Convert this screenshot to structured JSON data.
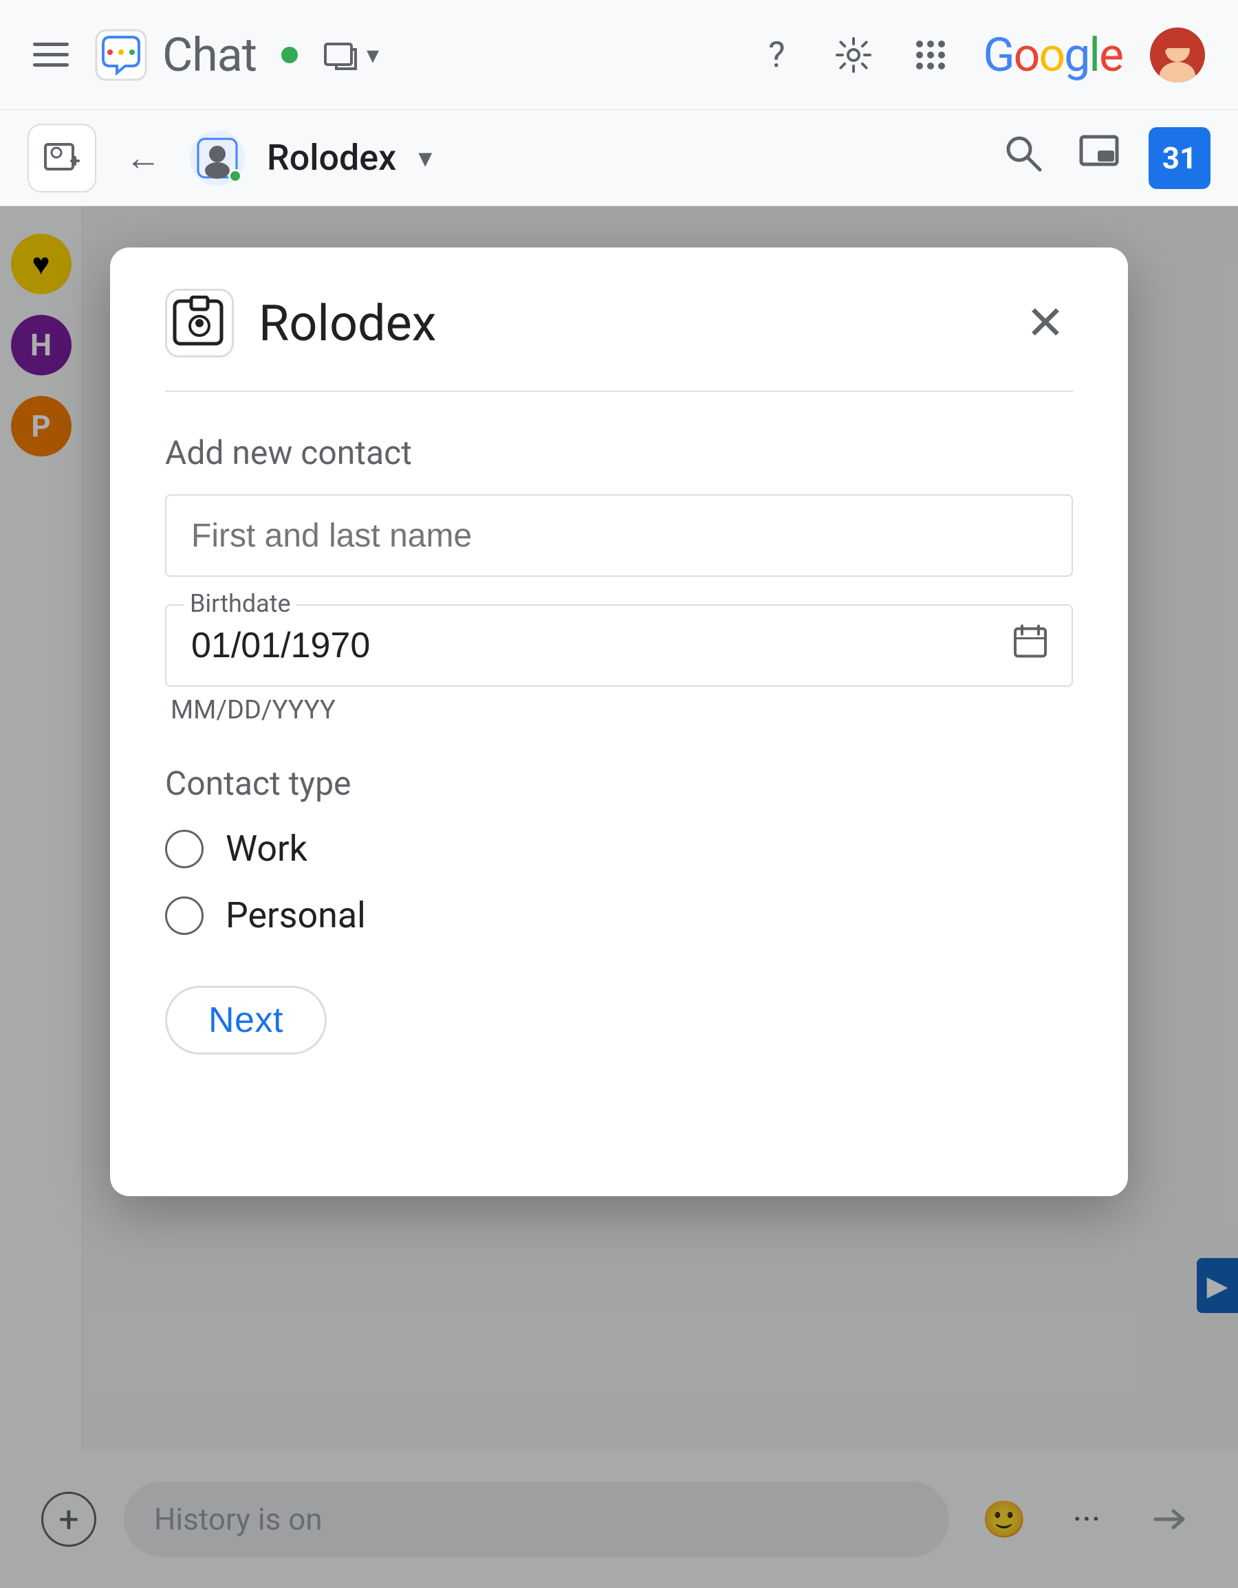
{
  "topbar": {
    "app_name": "Chat",
    "hamburger_label": "Main menu",
    "status_label": "Online",
    "help_label": "Help",
    "settings_label": "Settings",
    "apps_label": "Google apps",
    "google_logo": "Google",
    "window_label": "Window options"
  },
  "secondarybar": {
    "new_chat_label": "New chat",
    "back_label": "Back",
    "channel_name": "Rolodex",
    "chevron_label": "More options",
    "search_label": "Search",
    "pip_label": "Pop-out",
    "calendar_number": "31"
  },
  "modal": {
    "title": "Rolodex",
    "close_label": "Close",
    "section_title": "Add new contact",
    "name_placeholder": "First and last name",
    "birthdate_label": "Birthdate",
    "birthdate_value": "01/01/1970",
    "birthdate_format": "MM/DD/YYYY",
    "contact_type_label": "Contact type",
    "radio_work": "Work",
    "radio_personal": "Personal",
    "next_button": "Next"
  },
  "bottombar": {
    "add_label": "Add attachment",
    "message_placeholder": "History is on",
    "emoji_label": "Emoji",
    "more_label": "More options",
    "send_label": "Send"
  },
  "sidebar": {
    "heart_icon": "♥",
    "h_label": "H",
    "p_label": "P"
  }
}
